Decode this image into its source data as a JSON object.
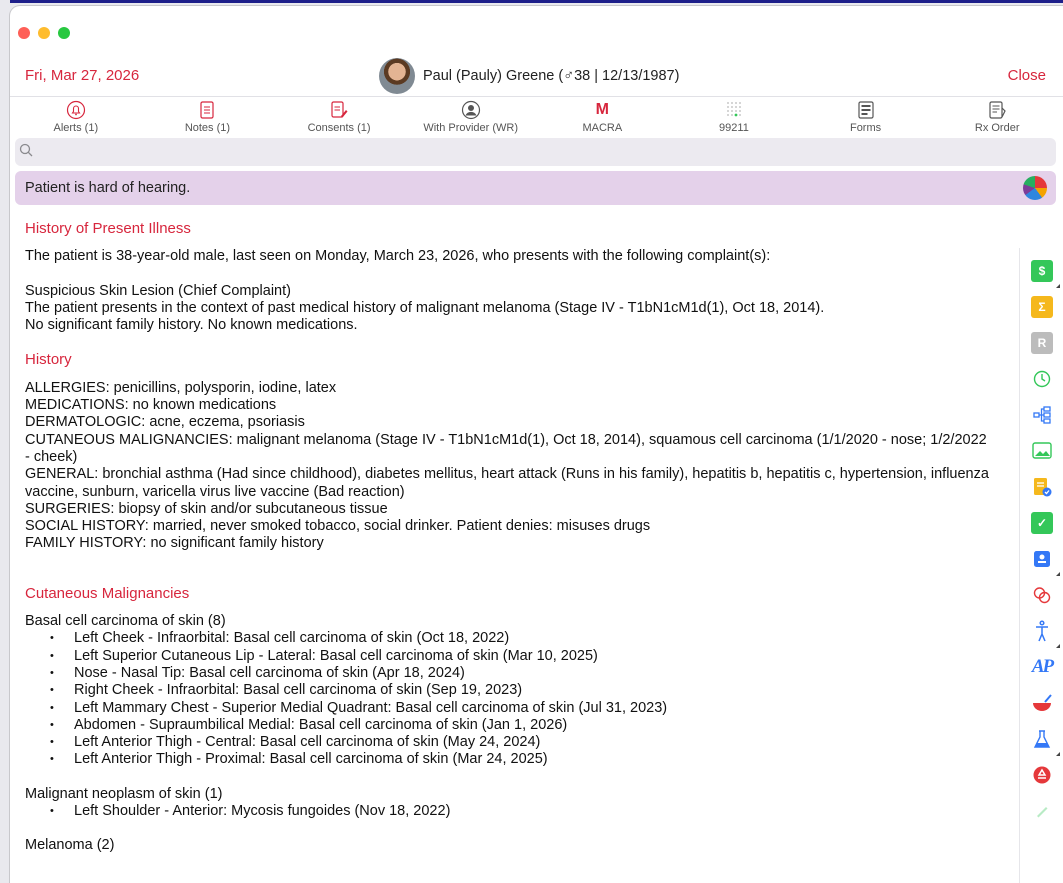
{
  "header": {
    "date": "Fri, Mar 27, 2026",
    "patient_name": "Paul (Pauly) Greene (♂38 | 12/13/1987)",
    "close_label": "Close"
  },
  "toolbar": [
    {
      "label": "Alerts (1)",
      "icon": "bell-icon"
    },
    {
      "label": "Notes (1)",
      "icon": "notes-icon"
    },
    {
      "label": "Consents (1)",
      "icon": "consents-icon"
    },
    {
      "label": "With Provider (WR)",
      "icon": "provider-icon"
    },
    {
      "label": "MACRA",
      "icon": "macra-icon",
      "glyph": "M"
    },
    {
      "label": "99211",
      "icon": "dots-grid-icon"
    },
    {
      "label": "Forms",
      "icon": "forms-icon"
    },
    {
      "label": "Rx Order",
      "icon": "rx-order-icon"
    }
  ],
  "search": {
    "placeholder": ""
  },
  "alert_banner": "Patient is hard of hearing.",
  "hpi": {
    "title": "History of Present Illness",
    "intro": "The patient is 38-year-old male, last seen on Monday, March 23, 2026, who presents with the following complaint(s):",
    "lines": [
      "Suspicious Skin Lesion (Chief Complaint)",
      "The patient presents in the context of past medical history of malignant melanoma (Stage IV - T1bN1cM1d(1), Oct 18, 2014).",
      "No significant family history. No known medications."
    ]
  },
  "history": {
    "title": "History",
    "lines": [
      "ALLERGIES: penicillins, polysporin, iodine, latex",
      "MEDICATIONS: no known medications",
      "DERMATOLOGIC: acne, eczema, psoriasis",
      "CUTANEOUS MALIGNANCIES: malignant melanoma (Stage IV - T1bN1cM1d(1), Oct 18, 2014), squamous cell carcinoma (1/1/2020 - nose; 1/2/2022 - cheek)",
      "GENERAL: bronchial asthma (Had since childhood), diabetes mellitus, heart attack (Runs in his family), hepatitis b, hepatitis c, hypertension, influenza vaccine, sunburn, varicella virus live vaccine (Bad reaction)",
      "SURGERIES: biopsy of skin and/or subcutaneous tissue",
      "SOCIAL HISTORY: married, never smoked tobacco, social drinker. Patient denies: misuses drugs",
      "FAMILY HISTORY: no significant family history"
    ]
  },
  "malignancies": {
    "title": "Cutaneous Malignancies",
    "groups": [
      {
        "heading": "Basal cell carcinoma of skin (8)",
        "items": [
          "Left Cheek - Infraorbital: Basal cell carcinoma of skin (Oct 18, 2022)",
          "Left Superior Cutaneous Lip - Lateral: Basal cell carcinoma of skin (Mar 10, 2025)",
          "Nose - Nasal Tip: Basal cell carcinoma of skin (Apr 18, 2024)",
          "Right Cheek - Infraorbital: Basal cell carcinoma of skin (Sep 19, 2023)",
          "Left Mammary Chest - Superior Medial Quadrant: Basal cell carcinoma of skin (Jul 31, 2023)",
          "Abdomen - Supraumbilical Medial: Basal cell carcinoma of skin (Jan 1, 2026)",
          "Left Anterior Thigh - Central: Basal cell carcinoma of skin (May 24, 2024)",
          "Left Anterior Thigh - Proximal: Basal cell carcinoma of skin (Mar 24, 2025)"
        ]
      },
      {
        "heading": "Malignant neoplasm of skin (1)",
        "items": [
          "Left Shoulder - Anterior: Mycosis fungoides (Nov 18, 2022)"
        ]
      },
      {
        "heading": "Melanoma (2)",
        "items": []
      }
    ]
  },
  "rail_icons": [
    {
      "name": "billing-icon",
      "glyph": "$",
      "color": "#34c759"
    },
    {
      "name": "sum-icon",
      "glyph": "Σ",
      "color": "#f5b81c"
    },
    {
      "name": "r-icon",
      "glyph": "R",
      "color": "#bcbcbc"
    },
    {
      "name": "timer-icon",
      "glyph": "",
      "color": "#34c759"
    },
    {
      "name": "flow-icon",
      "glyph": "",
      "color": "#3478f6"
    },
    {
      "name": "gallery-icon",
      "glyph": "",
      "color": "#34c759"
    },
    {
      "name": "doc-check-icon",
      "glyph": "",
      "color": "#f5b81c"
    },
    {
      "name": "checkbox-icon",
      "glyph": "✓",
      "color": "#34c759"
    },
    {
      "name": "contact-card-icon",
      "glyph": "",
      "color": "#3478f6"
    },
    {
      "name": "link-rings-icon",
      "glyph": "",
      "color": "#e5383b"
    },
    {
      "name": "body-figure-icon",
      "glyph": "",
      "color": "#3478f6"
    },
    {
      "name": "ap-icon",
      "glyph": "AP",
      "color": "#3478f6"
    },
    {
      "name": "rx-bowl-icon",
      "glyph": "",
      "color": "#e5383b"
    },
    {
      "name": "lab-flask-icon",
      "glyph": "",
      "color": "#3478f6"
    },
    {
      "name": "recycle-icon",
      "glyph": "",
      "color": "#e5383b"
    }
  ]
}
